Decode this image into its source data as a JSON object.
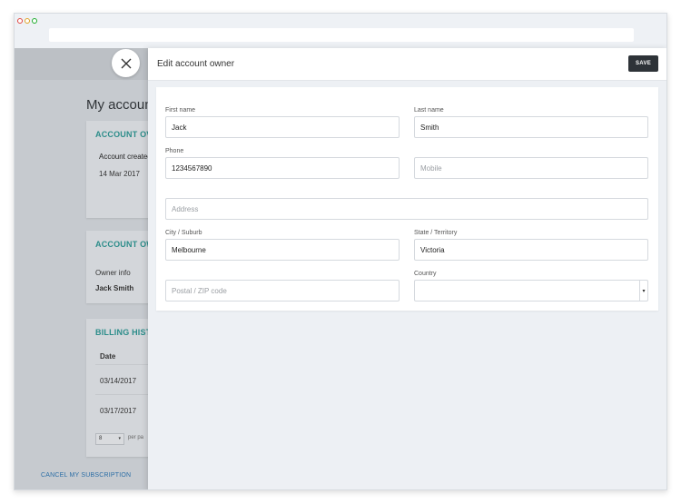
{
  "background": {
    "page_title": "My account",
    "cards": [
      {
        "heading": "ACCOUNT OVE",
        "label": "Account created",
        "value": "14 Mar 2017"
      },
      {
        "heading": "ACCOUNT OW",
        "label": "Owner info",
        "value": "Jack Smith"
      },
      {
        "heading": "BILLING HISTO",
        "column": "Date",
        "rows": [
          "03/14/2017",
          "03/17/2017"
        ],
        "per_page_value": "8",
        "per_page_label": "per pa"
      }
    ],
    "cancel_link": "CANCEL MY SUBSCRIPTION"
  },
  "panel": {
    "title": "Edit account owner",
    "save_label": "SAVE"
  },
  "form": {
    "first_name": {
      "label": "First name",
      "value": "Jack"
    },
    "last_name": {
      "label": "Last name",
      "value": "Smith"
    },
    "phone": {
      "label": "Phone",
      "value": "1234567890"
    },
    "mobile": {
      "placeholder": "Mobile"
    },
    "address": {
      "placeholder": "Address"
    },
    "city": {
      "label": "City / Suburb",
      "value": "Melbourne"
    },
    "state": {
      "label": "State / Territory",
      "value": "Victoria"
    },
    "postal": {
      "placeholder": "Postal / ZIP code"
    },
    "country": {
      "label": "Country",
      "value": ""
    }
  },
  "icons": {
    "close": "close-icon",
    "dropdown": "▾"
  },
  "colors": {
    "accent": "#2c8d8a",
    "save_button": "#2e3338",
    "link": "#2c6ea6"
  }
}
